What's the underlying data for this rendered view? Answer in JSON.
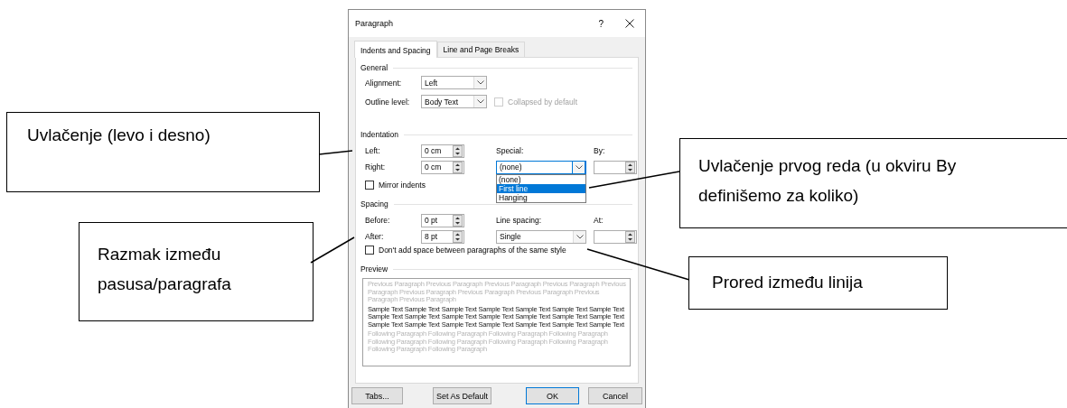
{
  "window": {
    "title": "Paragraph",
    "help": "?"
  },
  "tabs": [
    {
      "label": "Indents and Spacing",
      "selected": true
    },
    {
      "label": "Line and Page Breaks",
      "selected": false
    }
  ],
  "general": {
    "heading": "General",
    "alignment": {
      "label": "Alignment:",
      "value": "Left"
    },
    "outline_level": {
      "label": "Outline level:",
      "value": "Body Text"
    },
    "collapsed": {
      "label": "Collapsed by default",
      "checked": false,
      "disabled": true
    }
  },
  "indentation": {
    "heading": "Indentation",
    "left": {
      "label": "Left:",
      "value": "0 cm"
    },
    "right": {
      "label": "Right:",
      "value": "0 cm"
    },
    "special": {
      "label": "Special:",
      "value": "(none)",
      "expanded": true
    },
    "special_options": [
      {
        "label": "(none)",
        "selected": false
      },
      {
        "label": "First line",
        "selected": true
      },
      {
        "label": "Hanging",
        "selected": false
      }
    ],
    "by": {
      "label": "By:"
    },
    "mirror": {
      "label": "Mirror indents",
      "checked": false
    }
  },
  "spacing": {
    "heading": "Spacing",
    "before": {
      "label": "Before:",
      "value": "0 pt"
    },
    "after": {
      "label": "After:",
      "value": "8 pt"
    },
    "line_spacing": {
      "label": "Line spacing:",
      "value": "Single"
    },
    "at": {
      "label": "At:"
    },
    "dont_add": {
      "label": "Don't add space between paragraphs of the same style",
      "checked": false
    }
  },
  "preview": {
    "heading": "Preview",
    "previous": "Previous Paragraph Previous Paragraph Previous Paragraph Previous Paragraph Previous Paragraph Previous Paragraph Previous Paragraph Previous Paragraph Previous Paragraph Previous Paragraph",
    "sample": "Sample Text Sample Text Sample Text Sample Text Sample Text Sample Text Sample Text Sample Text Sample Text Sample Text Sample Text Sample Text Sample Text Sample Text Sample Text Sample Text Sample Text Sample Text Sample Text Sample Text Sample Text",
    "following": "Following Paragraph Following Paragraph Following Paragraph Following Paragraph Following Paragraph Following Paragraph Following Paragraph Following Paragraph Following Paragraph Following Paragraph"
  },
  "buttons": [
    {
      "label": "Tabs...",
      "default": false
    },
    {
      "label": "Set As Default",
      "default": false
    },
    {
      "label": "OK",
      "default": true
    },
    {
      "label": "Cancel",
      "default": false
    }
  ],
  "callouts": [
    {
      "text": "Uvlačenje (levo i desno)"
    },
    {
      "text": "Razmak između pasusa/paragrafa"
    },
    {
      "text": "Uvlačenje prvog reda (u okviru By definišemo za koliko)"
    },
    {
      "text": "Prored između linija"
    }
  ]
}
